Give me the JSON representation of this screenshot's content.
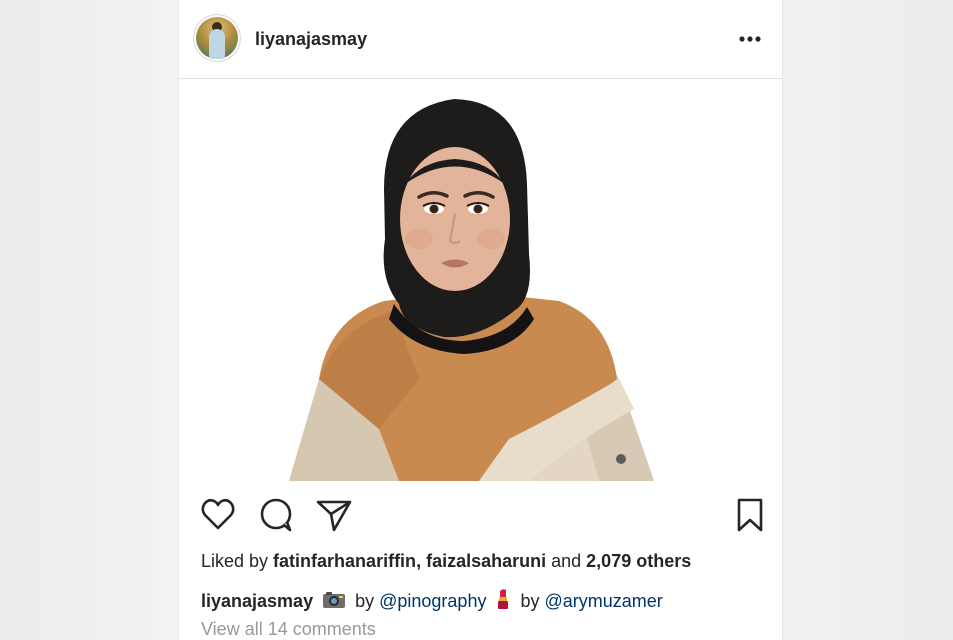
{
  "post": {
    "username": "liyanajasmay",
    "likes": {
      "prefix": "Liked by ",
      "user1": "fatinfarhanariffin",
      "separator": ", ",
      "user2": "faizalsaharuni",
      "and": " and ",
      "count": "2,079 others"
    },
    "caption": {
      "username": "liyanajasmay",
      "by1": " by ",
      "mention1": "@pinography",
      "by2": " by ",
      "mention2": "@arymuzamer"
    },
    "view_comments": "View all 14 comments"
  },
  "icons": {
    "camera": "camera-emoji-icon",
    "lipstick": "lipstick-emoji-icon",
    "more": "more-options-icon",
    "like": "heart-icon",
    "comment": "comment-icon",
    "share": "share-icon",
    "save": "bookmark-icon"
  },
  "colors": {
    "text": "#262626",
    "mention": "#003569",
    "muted": "#999999",
    "border": "#e3e3e3"
  }
}
